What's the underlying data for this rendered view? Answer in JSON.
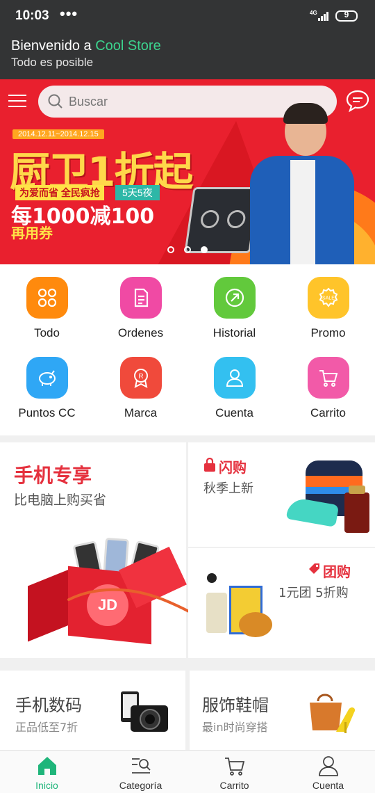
{
  "status": {
    "time": "10:03",
    "more": "•••",
    "network": "4G",
    "battery": "9"
  },
  "welcome": {
    "prefix": "Bienvenido a ",
    "brand": "Cool Store",
    "subtitle": "Todo es posible",
    "brand_color": "#3cd38e"
  },
  "search": {
    "placeholder": "Buscar"
  },
  "banner": {
    "date": "2014.12.11~2014.12.15",
    "title": "厨卫1折起",
    "tag": "为爱而省 全民疯抢",
    "days": "5天5夜",
    "offer": "每1000减100",
    "coupon": "再用券",
    "slides": 3,
    "active_slide": 2
  },
  "shortcuts": [
    {
      "label": "Todo",
      "icon": "grid-icon",
      "color": "#ff8a0d"
    },
    {
      "label": "Ordenes",
      "icon": "document-icon",
      "color": "#f04aa4"
    },
    {
      "label": "Historial",
      "icon": "history-icon",
      "color": "#62c93c"
    },
    {
      "label": "Promo",
      "icon": "sale-icon",
      "color": "#ffc42a"
    },
    {
      "label": "Puntos CC",
      "icon": "piggy-bank-icon",
      "color": "#2fa7f5"
    },
    {
      "label": "Marca",
      "icon": "badge-icon",
      "color": "#f04a3b"
    },
    {
      "label": "Cuenta",
      "icon": "user-icon",
      "color": "#33c0f0"
    },
    {
      "label": "Carrito",
      "icon": "cart-icon",
      "color": "#f25aa8"
    }
  ],
  "promos": {
    "mobile": {
      "title": "手机专享",
      "subtitle": "比电脑上购买省"
    },
    "flash": {
      "title": "闪购",
      "subtitle": "秋季上新"
    },
    "group": {
      "title": "团购",
      "subtitle": "1元团 5折购"
    },
    "jd": "JD"
  },
  "tiles": [
    {
      "title": "手机数码",
      "subtitle": "正品低至7折"
    },
    {
      "title": "服饰鞋帽",
      "subtitle": "最in时尚穿搭"
    }
  ],
  "nav": [
    {
      "label": "Inicio",
      "active": true
    },
    {
      "label": "Categoría",
      "active": false
    },
    {
      "label": "Carrito",
      "active": false
    },
    {
      "label": "Cuenta",
      "active": false
    }
  ],
  "colors": {
    "accent": "#1fb57a",
    "header_bg": "#333435",
    "banner_red": "#e9202e",
    "promo_red": "#e5313e"
  }
}
